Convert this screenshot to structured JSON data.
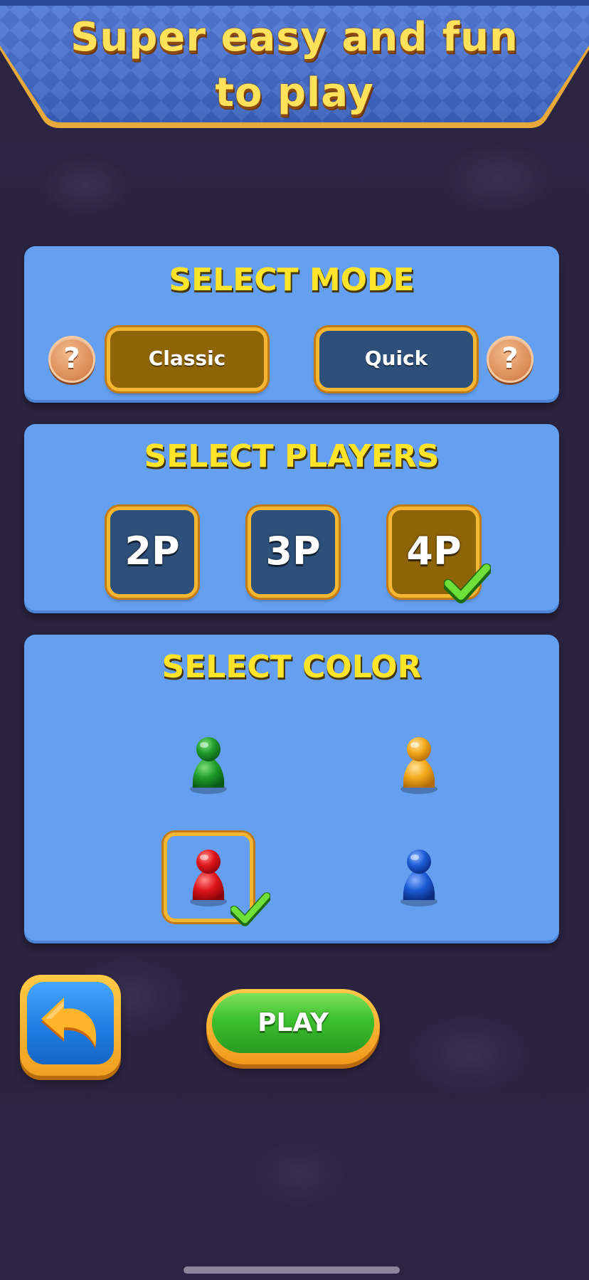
{
  "header": {
    "title_line1": "Super easy and fun",
    "title_line2": "to play"
  },
  "mode": {
    "title": "SELECT MODE",
    "help_label": "?",
    "options": [
      {
        "label": "Classic",
        "selected": true
      },
      {
        "label": "Quick",
        "selected": false
      }
    ]
  },
  "players": {
    "title": "SELECT PLAYERS",
    "options": [
      {
        "label": "2P",
        "selected": false
      },
      {
        "label": "3P",
        "selected": false
      },
      {
        "label": "4P",
        "selected": true
      }
    ]
  },
  "color": {
    "title": "SELECT COLOR",
    "pawns": [
      {
        "color": "green",
        "hex": "#1f9a2c",
        "selected": false
      },
      {
        "color": "yellow",
        "hex": "#f2a81a",
        "selected": false
      },
      {
        "color": "red",
        "hex": "#e0141c",
        "selected": true
      },
      {
        "color": "blue",
        "hex": "#1c5bd6",
        "selected": false
      }
    ]
  },
  "actions": {
    "back_icon": "undo-arrow-icon",
    "play_label": "PLAY"
  },
  "theme": {
    "panel_bg": "#65a0f0",
    "selected_bg": "#8e6408",
    "unselected_bg": "#2d4f7a",
    "accent_border": "#f5b632",
    "title_yellow": "#ffe42a"
  }
}
